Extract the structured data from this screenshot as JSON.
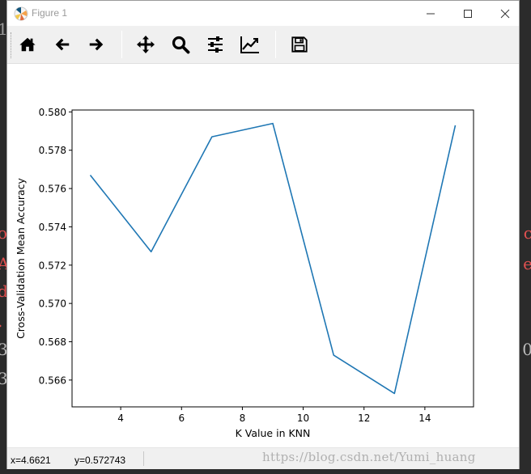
{
  "window": {
    "title": "Figure 1"
  },
  "toolbar": {
    "buttons": [
      {
        "name": "home",
        "icon": "home-icon"
      },
      {
        "name": "back",
        "icon": "arrow-left-icon"
      },
      {
        "name": "forward",
        "icon": "arrow-right-icon"
      },
      {
        "name": "pan",
        "icon": "move-icon"
      },
      {
        "name": "zoom",
        "icon": "magnifier-icon"
      },
      {
        "name": "subplots",
        "icon": "sliders-icon"
      },
      {
        "name": "edit-axis",
        "icon": "line-chart-icon"
      },
      {
        "name": "save",
        "icon": "floppy-disk-icon"
      }
    ]
  },
  "status": {
    "x": "x=4.6621",
    "y": "y=0.572743"
  },
  "watermark": "https://blog.csdn.net/Yumi_huang",
  "colors": {
    "line": "#1f77b4",
    "axes": "#000000",
    "toolbar_bg": "#f0f0f0"
  },
  "chart_data": {
    "type": "line",
    "x": [
      3,
      5,
      7,
      9,
      11,
      13,
      15
    ],
    "series": [
      {
        "values": [
          0.5767,
          0.5727,
          0.5787,
          0.5794,
          0.5673,
          0.5653,
          0.5793
        ]
      }
    ],
    "xlabel": "K Value in KNN",
    "ylabel": "Cross-Validation Mean Accuracy",
    "xlim": [
      2.4,
      15.6
    ],
    "ylim": [
      0.5646,
      0.5801
    ],
    "xticks": [
      4,
      6,
      8,
      10,
      12,
      14
    ],
    "xtick_labels": [
      "4",
      "6",
      "8",
      "10",
      "12",
      "14"
    ],
    "yticks": [
      0.566,
      0.568,
      0.57,
      0.572,
      0.574,
      0.576,
      0.578,
      0.58
    ],
    "ytick_labels": [
      "0.566",
      "0.568",
      "0.570",
      "0.572",
      "0.574",
      "0.576",
      "0.578",
      "0.580"
    ],
    "grid": false
  }
}
